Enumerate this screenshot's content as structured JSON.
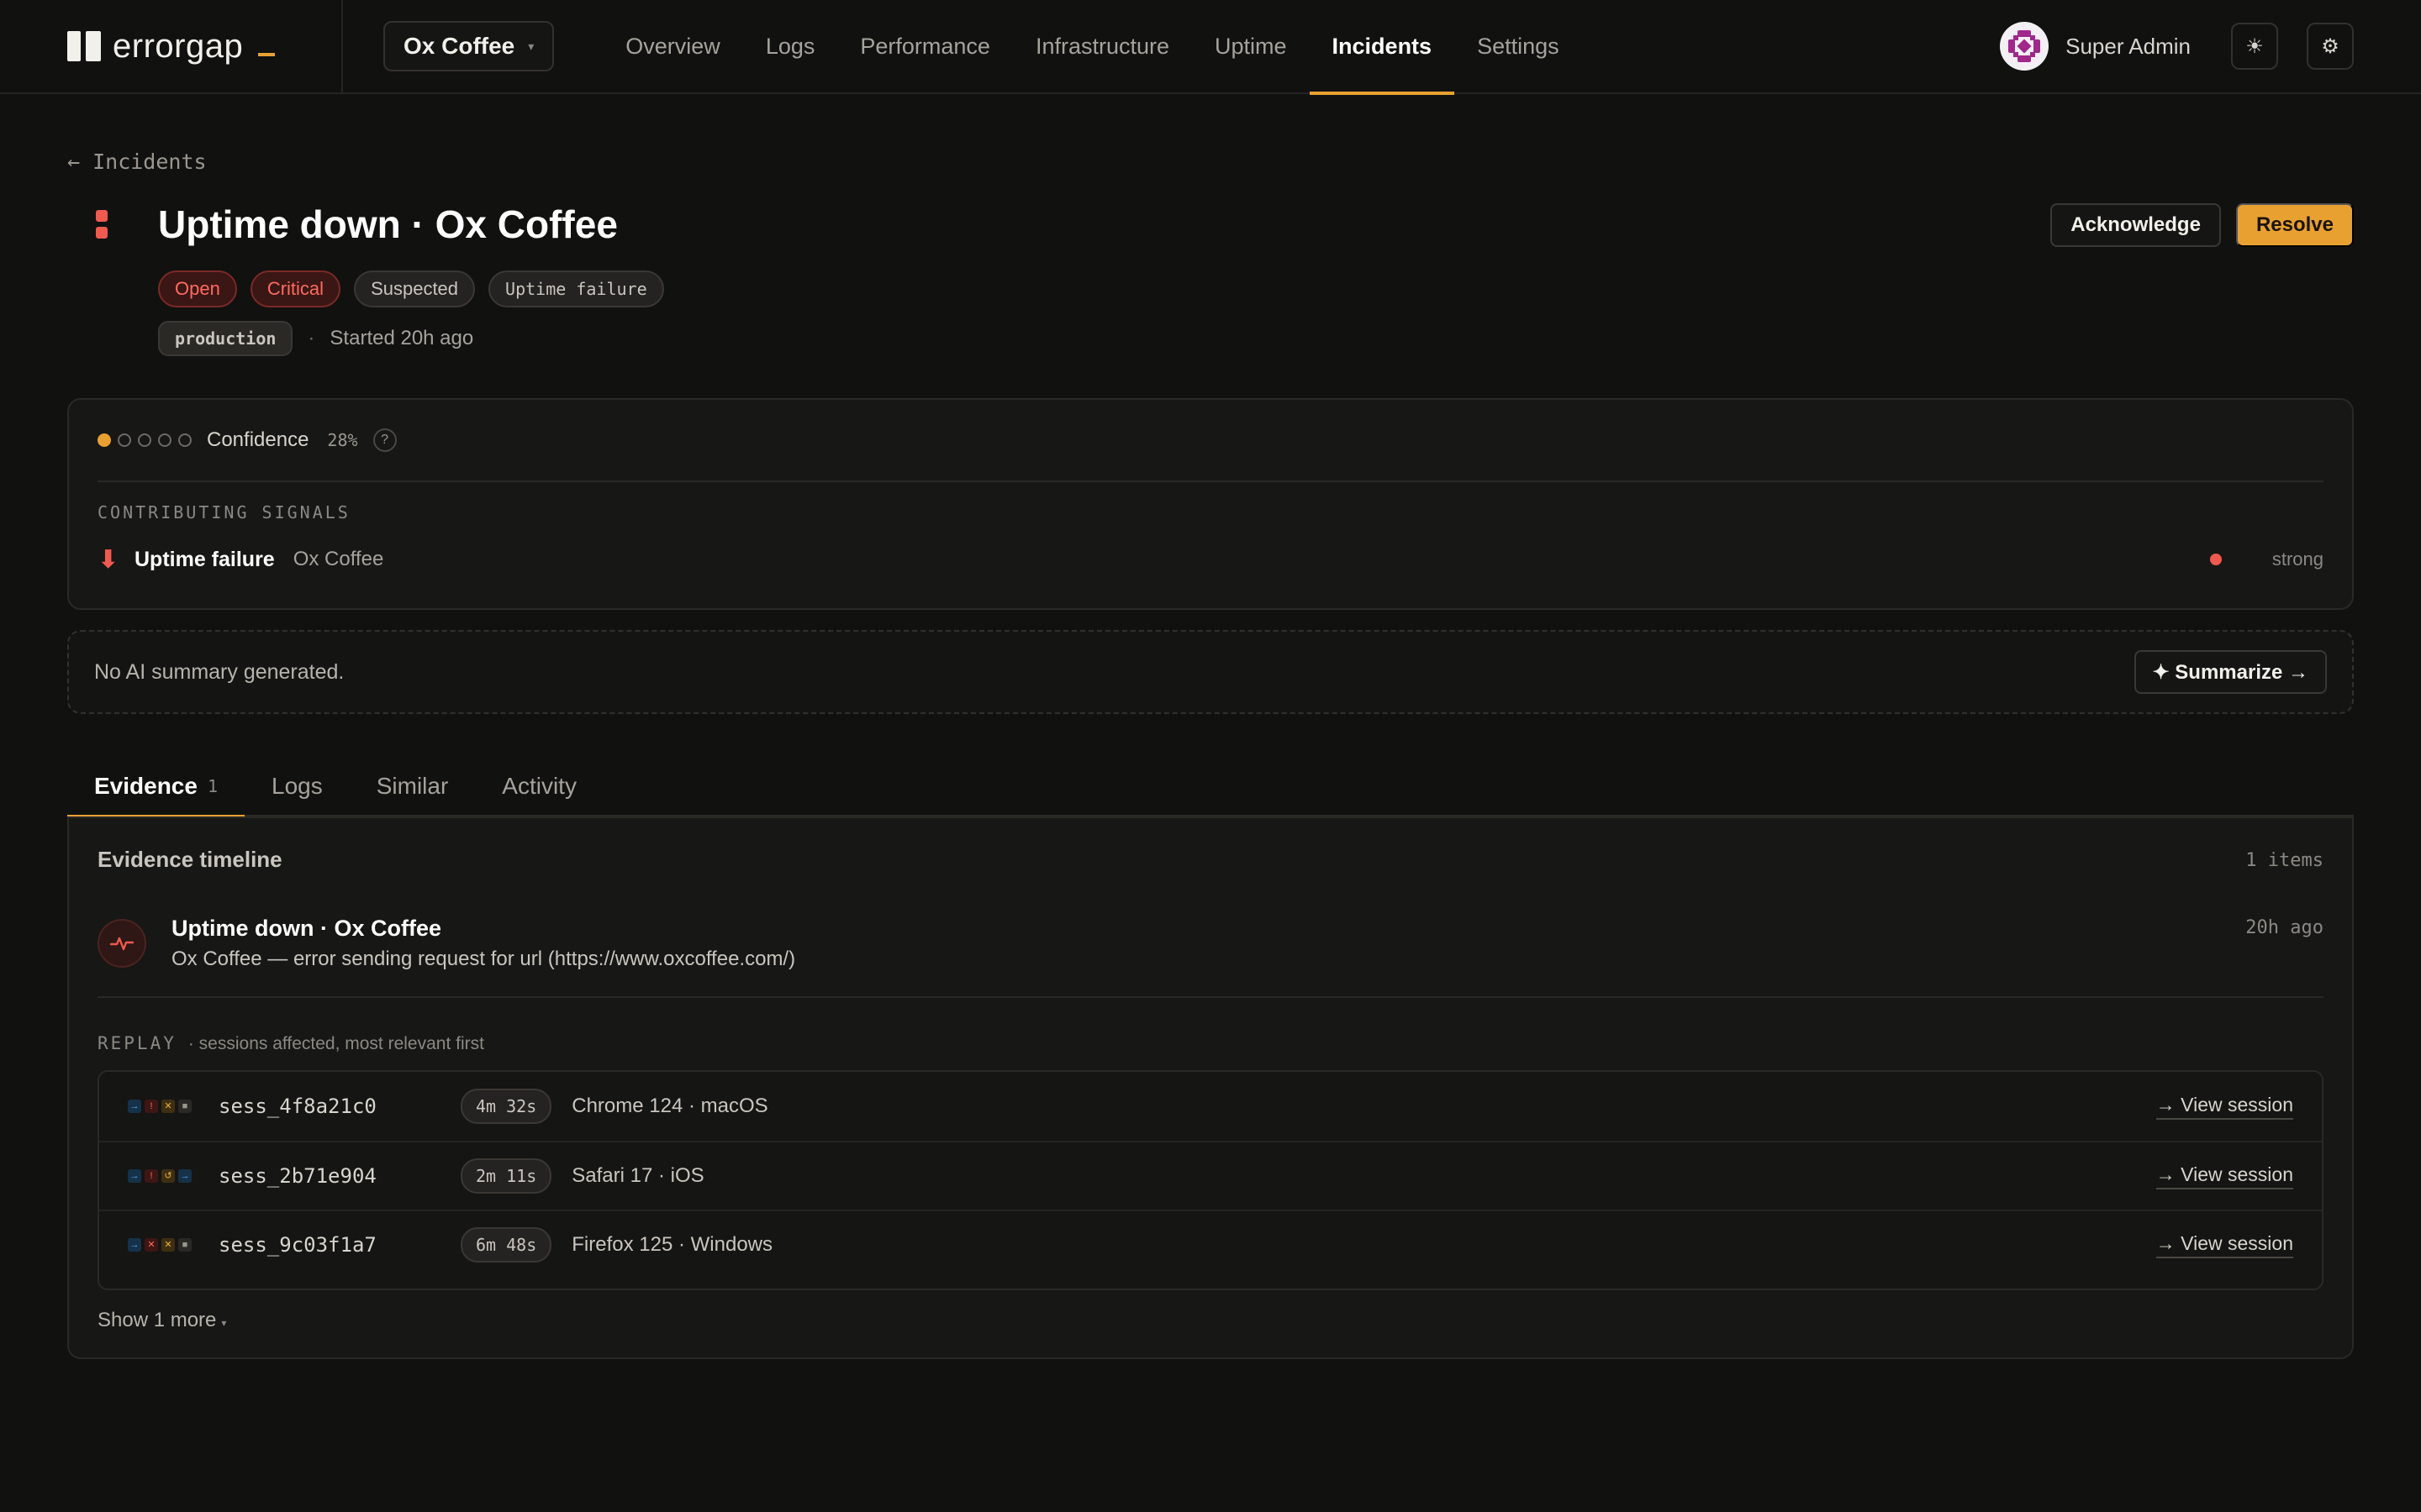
{
  "brand": {
    "name": "errorgap"
  },
  "project": {
    "name": "Ox Coffee"
  },
  "nav": [
    {
      "label": "Overview"
    },
    {
      "label": "Logs"
    },
    {
      "label": "Performance"
    },
    {
      "label": "Infrastructure"
    },
    {
      "label": "Uptime"
    },
    {
      "label": "Incidents"
    },
    {
      "label": "Settings"
    }
  ],
  "nav_active": "Incidents",
  "user": {
    "name": "Super Admin",
    "theme_icon": "sun-icon",
    "settings_icon": "gear-icon"
  },
  "back": {
    "label": "← Incidents"
  },
  "incident": {
    "title": "Uptime down · Ox Coffee",
    "badges": {
      "status": "Open",
      "severity": "Critical",
      "confidence": "Suspected",
      "kind": "Uptime failure"
    },
    "environment": "production",
    "separator": "·",
    "started": "Started 20h ago"
  },
  "actions": {
    "acknowledge": "Acknowledge",
    "resolve": "Resolve"
  },
  "confidence": {
    "label": "Confidence",
    "percent": "28%",
    "level": 1,
    "max_level": 5,
    "help": "?",
    "signals_heading": "CONTRIBUTING SIGNALS",
    "signal": {
      "name": "Uptime failure",
      "source": "Ox Coffee",
      "strength": "strong",
      "color": "#ef5a50"
    }
  },
  "ai_summary": {
    "text": "No AI summary generated.",
    "button": "✦ Summarize →"
  },
  "tabs": [
    {
      "label": "Evidence",
      "count": "1"
    },
    {
      "label": "Logs"
    },
    {
      "label": "Similar"
    },
    {
      "label": "Activity"
    }
  ],
  "evidence": {
    "title": "Evidence timeline",
    "count": "1 items",
    "item": {
      "title": "Uptime down · Ox Coffee",
      "description": "Ox Coffee — error sending request for url (https://www.oxcoffee.com/)",
      "time": "20h ago",
      "icon": "pulse-icon"
    },
    "replay_label": "REPLAY",
    "replay_sub": "· sessions affected, most relevant first",
    "sessions": [
      {
        "id": "sess_4f8a21c0",
        "duration": "4m 32s",
        "browser": "Chrome 124 · macOS",
        "action": "→ View session"
      },
      {
        "id": "sess_2b71e904",
        "duration": "2m 11s",
        "browser": "Safari 17 · iOS",
        "action": "→ View session"
      },
      {
        "id": "sess_9c03f1a7",
        "duration": "6m 48s",
        "browser": "Firefox 125 · Windows",
        "action": "→ View session"
      }
    ],
    "show_more": "Show 1 more",
    "show_more_caret": "▾"
  },
  "colors": {
    "accent": "#e8a131",
    "danger": "#ef5a50",
    "background": "#111110"
  }
}
